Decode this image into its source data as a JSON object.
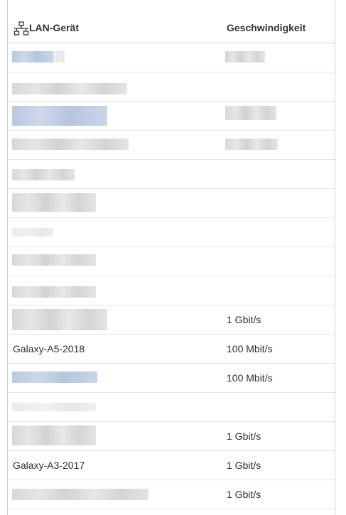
{
  "table": {
    "header": {
      "device_label": "LAN-Gerät",
      "speed_label": "Geschwindigkeit",
      "icon": "network-icon"
    },
    "rows": [
      {
        "name": "",
        "speed": ""
      },
      {
        "name": "",
        "speed": ""
      },
      {
        "name": "",
        "speed": ""
      },
      {
        "name": "",
        "speed": ""
      },
      {
        "name": "",
        "speed": ""
      },
      {
        "name": "",
        "speed": ""
      },
      {
        "name": "",
        "speed": ""
      },
      {
        "name": "",
        "speed": ""
      },
      {
        "name": "",
        "speed": ""
      },
      {
        "name": "",
        "speed": "1 Gbit/s"
      },
      {
        "name": "Galaxy-A5-2018",
        "speed": "100 Mbit/s"
      },
      {
        "name": "",
        "speed": "100 Mbit/s"
      },
      {
        "name": "",
        "speed": ""
      },
      {
        "name": "",
        "speed": "1 Gbit/s"
      },
      {
        "name": "Galaxy-A3-2017",
        "speed": "1 Gbit/s"
      },
      {
        "name": "",
        "speed": "1 Gbit/s"
      }
    ]
  },
  "colors": {
    "border": "#cfcfcf",
    "row_divider": "#e4e4e4",
    "text": "#2e2e2e"
  }
}
